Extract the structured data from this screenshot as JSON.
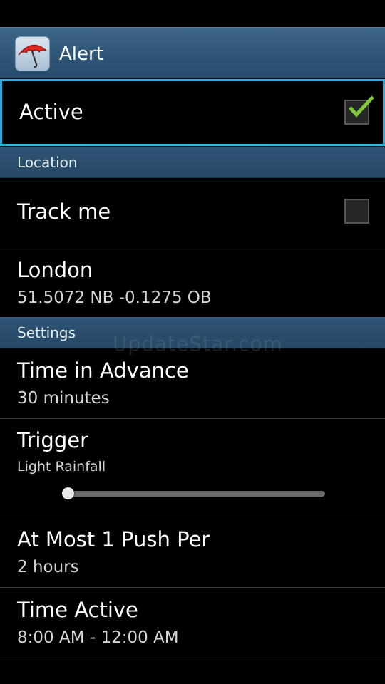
{
  "app": {
    "title": "Alert",
    "icon": "umbrella-icon"
  },
  "colors": {
    "action_bar": "#2d5575",
    "section_header": "#2b4e6e",
    "focus_border": "#33aadd",
    "checkmark": "#7ec83a"
  },
  "active": {
    "label": "Active",
    "checked": true
  },
  "location": {
    "header": "Location",
    "track_me": {
      "label": "Track me",
      "checked": false
    },
    "place": {
      "title": "London",
      "summary": "51.5072 NB -0.1275 OB"
    }
  },
  "settings": {
    "header": "Settings",
    "time_in_advance": {
      "title": "Time in Advance",
      "summary": "30 minutes"
    },
    "trigger": {
      "title": "Trigger",
      "summary": "Light Rainfall",
      "slider_value_fraction": 0.02
    },
    "push_limit": {
      "title": "At Most 1 Push Per",
      "summary": "2 hours"
    },
    "time_active": {
      "title": "Time Active",
      "summary": "8:00 AM - 12:00 AM"
    }
  },
  "watermark": "UpdateStar.com"
}
